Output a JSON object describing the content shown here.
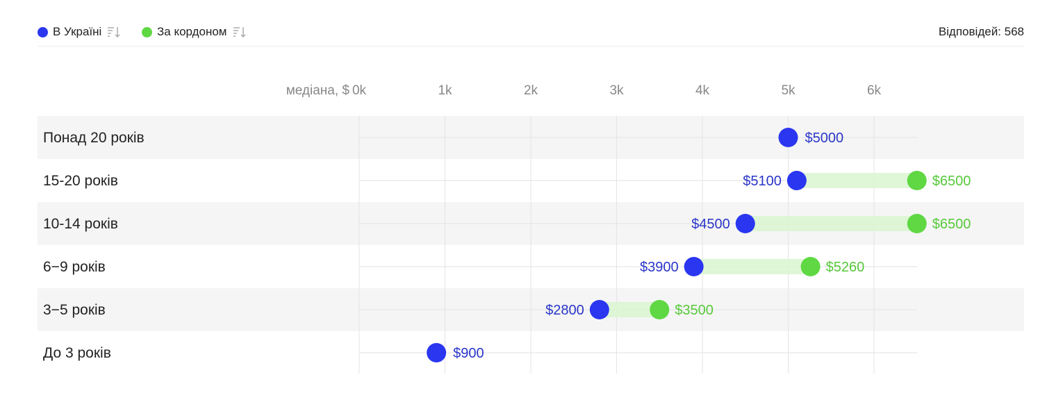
{
  "legend": {
    "items": [
      {
        "label": "В Україні",
        "color": "#2a36f0",
        "icon": "sort-descending-icon"
      },
      {
        "label": "За кордоном",
        "color": "#5fd843",
        "icon": "sort-descending-icon"
      }
    ],
    "responses_label": "Відповідей: 568"
  },
  "chart_data": {
    "type": "dumbbell",
    "axis_label": "медіана, $",
    "ticks": [
      {
        "value": 0,
        "label": "0k"
      },
      {
        "value": 1000,
        "label": "1k"
      },
      {
        "value": 2000,
        "label": "2k"
      },
      {
        "value": 3000,
        "label": "3k"
      },
      {
        "value": 4000,
        "label": "4k"
      },
      {
        "value": 5000,
        "label": "5k"
      },
      {
        "value": 6000,
        "label": "6k"
      }
    ],
    "xlim": [
      0,
      6500
    ],
    "series": [
      {
        "name": "В Україні",
        "color": "#2a36f0",
        "text_color": "#2a36c8"
      },
      {
        "name": "За кордоном",
        "color": "#5fd843",
        "text_color": "#56c93a"
      }
    ],
    "categories": [
      "Понад 20 років",
      "15-20 років",
      "10-14 років",
      "6−9 років",
      "3−5 років",
      "До 3 років"
    ],
    "rows": [
      {
        "category": "Понад 20 років",
        "ukraine": 5000,
        "ukraine_label": "$5000",
        "abroad": null,
        "abroad_label": ""
      },
      {
        "category": "15-20 років",
        "ukraine": 5100,
        "ukraine_label": "$5100",
        "abroad": 6500,
        "abroad_label": "$6500"
      },
      {
        "category": "10-14 років",
        "ukraine": 4500,
        "ukraine_label": "$4500",
        "abroad": 6500,
        "abroad_label": "$6500"
      },
      {
        "category": "6−9 років",
        "ukraine": 3900,
        "ukraine_label": "$3900",
        "abroad": 5260,
        "abroad_label": "$5260"
      },
      {
        "category": "3−5 років",
        "ukraine": 2800,
        "ukraine_label": "$2800",
        "abroad": 3500,
        "abroad_label": "$3500"
      },
      {
        "category": "До 3 років",
        "ukraine": 900,
        "ukraine_label": "$900",
        "abroad": null,
        "abroad_label": ""
      }
    ],
    "striped_rows": true,
    "grid": true
  }
}
